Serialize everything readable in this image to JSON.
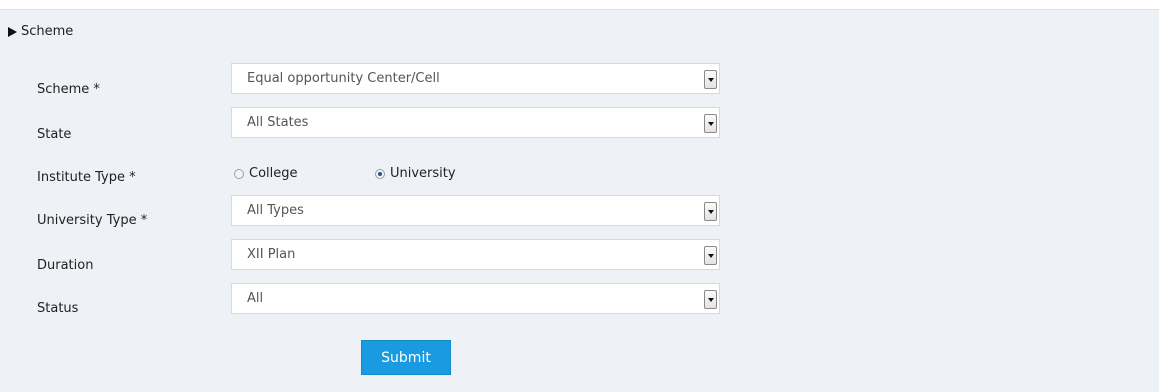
{
  "form": {
    "legend": "Scheme",
    "fields": {
      "scheme": {
        "label": "Scheme *",
        "value": "Equal opportunity Center/Cell"
      },
      "state": {
        "label": "State",
        "value": "All States"
      },
      "institute_type": {
        "label": "Institute Type *",
        "options": [
          "College",
          "University"
        ],
        "selected": "University"
      },
      "university_type": {
        "label": "University Type *",
        "value": "All Types"
      },
      "duration": {
        "label": "Duration",
        "value": "XII Plan"
      },
      "status": {
        "label": "Status",
        "value": "All"
      }
    },
    "submit_label": "Submit"
  }
}
